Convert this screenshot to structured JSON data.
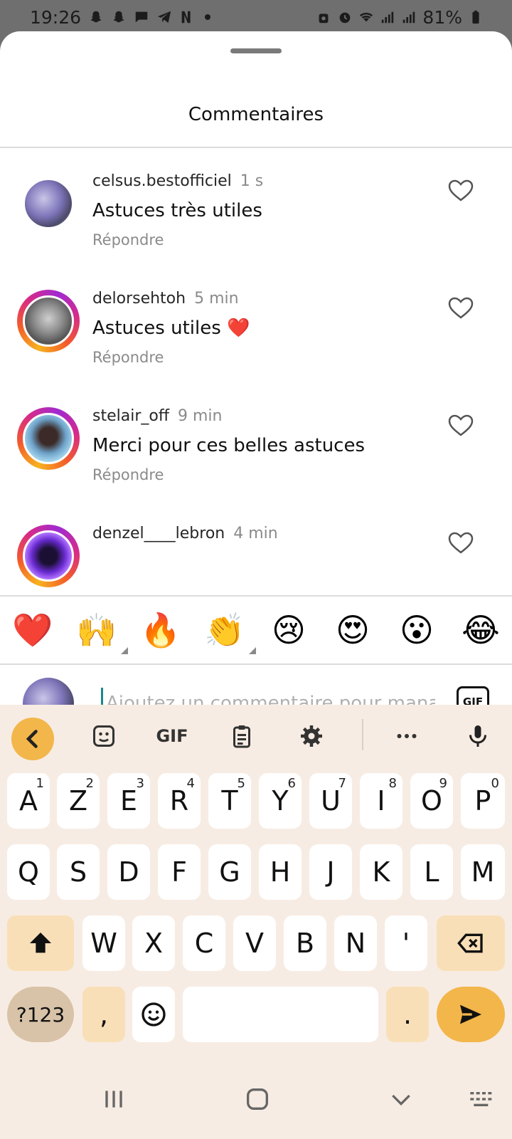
{
  "status_bar": {
    "time": "19:26",
    "battery": "81%"
  },
  "sheet": {
    "title": "Commentaires"
  },
  "comments": [
    {
      "username": "celsus.bestofficiel",
      "time": "1 s",
      "text": "Astuces très utiles",
      "reply_label": "Répondre",
      "has_story": false
    },
    {
      "username": "delorsehtoh",
      "time": "5 min",
      "text": "Astuces utiles ❤️",
      "reply_label": "Répondre",
      "has_story": true
    },
    {
      "username": "stelair_off",
      "time": "9 min",
      "text": "Merci pour ces belles astuces",
      "reply_label": "Répondre",
      "has_story": true
    },
    {
      "username": "denzel____lebron",
      "time": "4 min",
      "text": "",
      "reply_label": "",
      "has_story": true
    }
  ],
  "emoji_bar": [
    "❤️",
    "🙌",
    "🔥",
    "👏",
    "😢",
    "😍",
    "😮",
    "😂"
  ],
  "comment_input": {
    "placeholder": "Ajoutez un commentaire pour manage",
    "gif_label": "GIF"
  },
  "keyboard": {
    "toolbar": {
      "gif_label": "GIF"
    },
    "row1": [
      {
        "key": "A",
        "num": "1"
      },
      {
        "key": "Z",
        "num": "2"
      },
      {
        "key": "E",
        "num": "3"
      },
      {
        "key": "R",
        "num": "4"
      },
      {
        "key": "T",
        "num": "5"
      },
      {
        "key": "Y",
        "num": "6"
      },
      {
        "key": "U",
        "num": "7"
      },
      {
        "key": "I",
        "num": "8"
      },
      {
        "key": "O",
        "num": "9"
      },
      {
        "key": "P",
        "num": "0"
      }
    ],
    "row2": [
      "Q",
      "S",
      "D",
      "F",
      "G",
      "H",
      "J",
      "K",
      "L",
      "M"
    ],
    "row3": [
      "W",
      "X",
      "C",
      "V",
      "B",
      "N",
      "'"
    ],
    "row4": {
      "symbols": "?123",
      "comma": ",",
      "period": "."
    }
  },
  "colors": {
    "accent_keyboard": "#f2b64a",
    "keyboard_bg": "#f7ece3",
    "func_key": "#f9dfb7",
    "cursor": "#1a8a88"
  }
}
